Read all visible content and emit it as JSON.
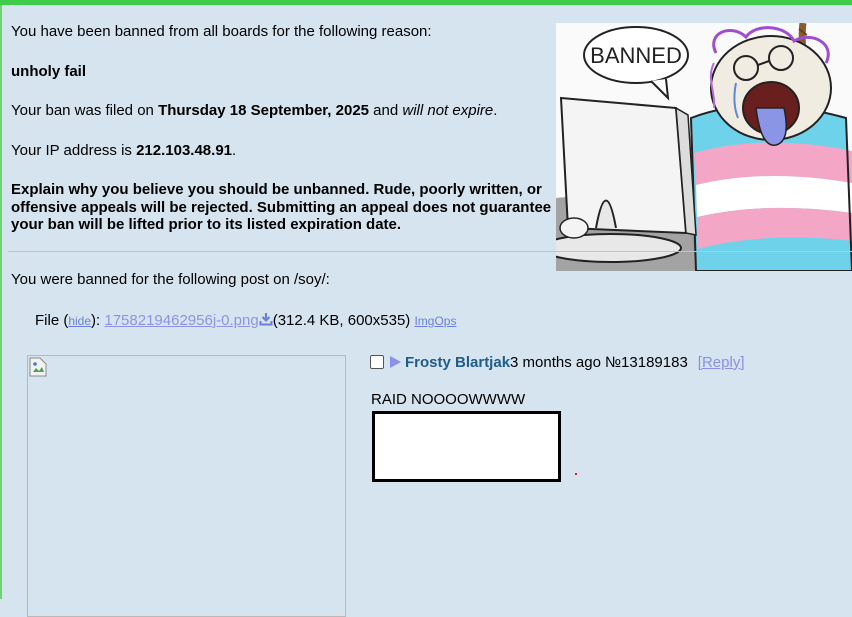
{
  "ban": {
    "intro": "You have been banned from all boards for the following reason:",
    "reason": "unholy fail",
    "filed_prefix": "Your ban was filed on ",
    "filed_date": "Thursday 18 September, 2025",
    "filed_and": " and ",
    "filed_expiry": "will not expire",
    "filed_suffix": ".",
    "ip_prefix": "Your IP address is ",
    "ip": "212.103.48.91",
    "ip_suffix": ".",
    "appeal_text": "Explain why you believe you should be unbanned. Rude, poorly written, or offensive appeals will be rejected. Submitting an appeal does not guarantee your ban will be lifted prior to its listed expiration date.",
    "banned_for": "You were banned for the following post on /soy/:"
  },
  "banner_image": {
    "speech_text": "BANNED"
  },
  "file": {
    "label": "File (",
    "hide": "hide",
    "after_hide": "): ",
    "filename": "1758219462956j-0.png",
    "meta": "(312.4 KB, 600x535)",
    "imgops": "ImgOps"
  },
  "post": {
    "name": "Frosty Blartjak",
    "time": "3 months ago",
    "number": "№13189183",
    "reply": "[Reply]",
    "body": "RAID NOOOOWWWW"
  },
  "colors": {
    "background": "#d6e4ef",
    "top_bar": "#3fcc4a",
    "poster_name": "#1f5c88",
    "link": "#8a90e0"
  },
  "icons": [
    "download-icon",
    "triangle-marker-icon",
    "broken-image-icon"
  ]
}
